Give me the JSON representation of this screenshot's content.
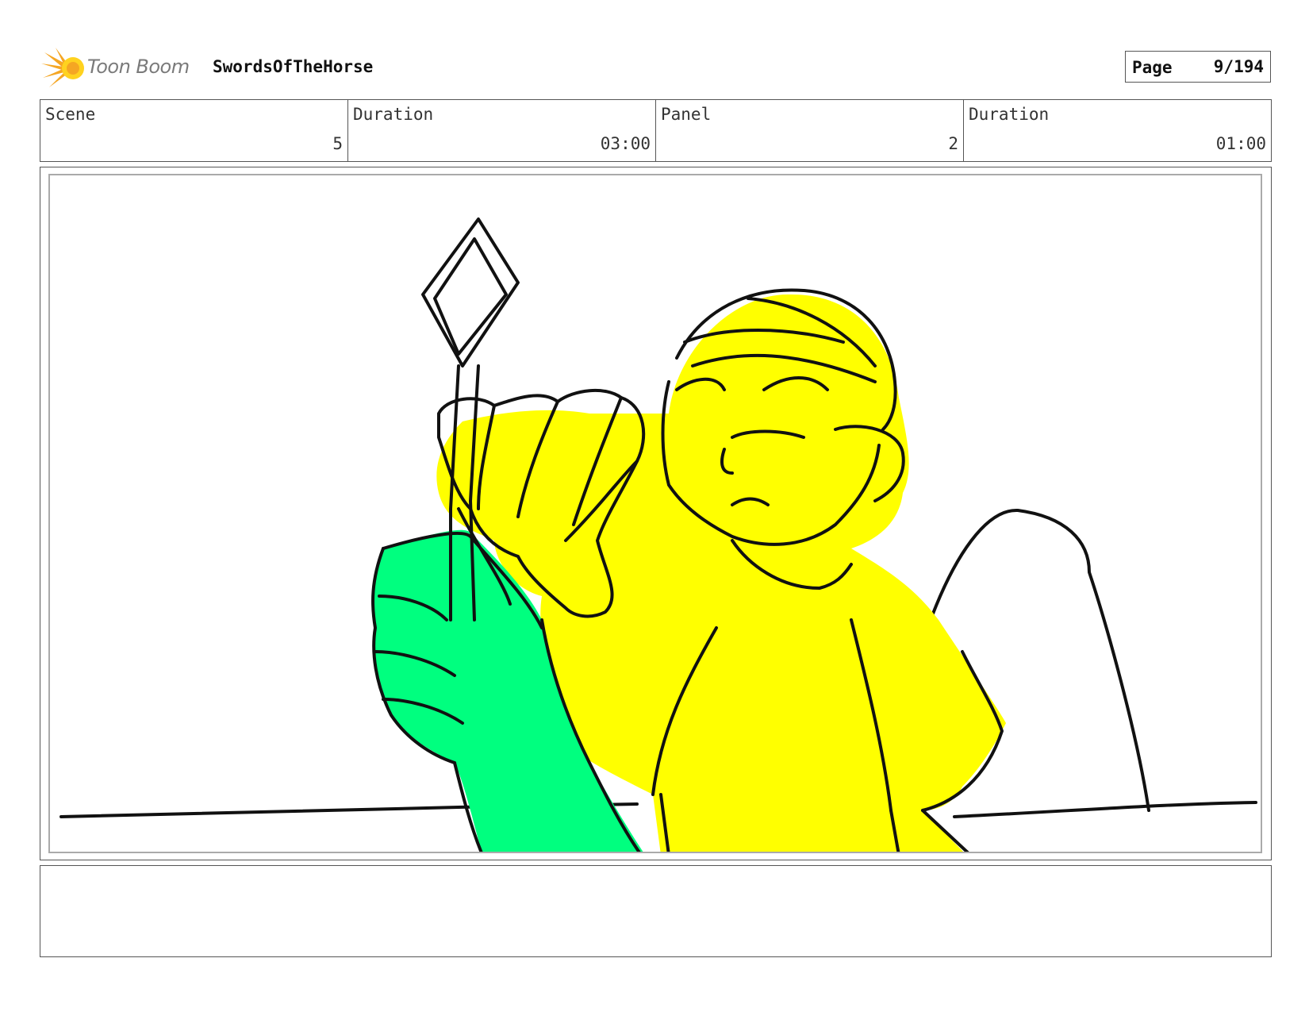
{
  "header": {
    "logo_text": "Toon Boom",
    "project_title": "SwordsOfTheHorse",
    "page_label": "Page",
    "page_value": "9/194"
  },
  "info": {
    "scene_label": "Scene",
    "scene_value": "5",
    "scene_duration_label": "Duration",
    "scene_duration_value": "03:00",
    "panel_label": "Panel",
    "panel_value": "2",
    "panel_duration_label": "Duration",
    "panel_duration_value": "01:00"
  },
  "colors": {
    "logo_orange": "#f5a623",
    "logo_yellow": "#ffd21f",
    "character_yellow": "#ffff00",
    "hand_green": "#00ff7f",
    "ink": "#111111"
  },
  "icons": {
    "logo": "toon-boom-starburst-icon"
  }
}
